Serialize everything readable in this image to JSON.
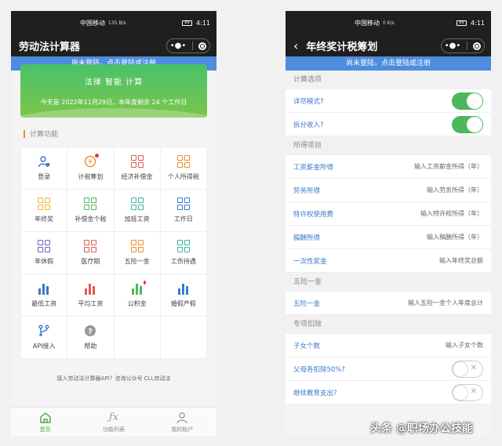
{
  "status": {
    "carrier": "中国移动",
    "net_speed": "135 B/s",
    "net_speed_right": "0 K/s",
    "battery": "89",
    "time": "4:11"
  },
  "left": {
    "title": "劳动法计算器",
    "login_hint": "尚未登陆，点击登陆或注册",
    "banner": {
      "line1": "法律 智能 计算",
      "line2": "今天是 2022年11月29日，本年度剩余 24 个工作日"
    },
    "section": "计算功能",
    "features": [
      {
        "label": "登录",
        "icon": "user-icon",
        "color": "#3b78c9"
      },
      {
        "label": "计税筹划",
        "icon": "money-icon",
        "color": "#f08c2c"
      },
      {
        "label": "经济补偿金",
        "icon": "grid-icon",
        "color": "#e05a4f"
      },
      {
        "label": "个人所得税",
        "icon": "grid-icon",
        "color": "#f08c2c"
      },
      {
        "label": "年终奖",
        "icon": "grid-icon",
        "color": "#f0b429"
      },
      {
        "label": "补偿金个税",
        "icon": "grid-icon",
        "color": "#4cb85b"
      },
      {
        "label": "加班工资",
        "icon": "grid-icon",
        "color": "#3bb5a6"
      },
      {
        "label": "工作日",
        "icon": "grid-icon",
        "color": "#3b78c9"
      },
      {
        "label": "年休假",
        "icon": "grid-icon",
        "color": "#7b5bc9"
      },
      {
        "label": "医疗期",
        "icon": "grid-icon",
        "color": "#e05a4f"
      },
      {
        "label": "五险一金",
        "icon": "grid-icon",
        "color": "#f08c2c"
      },
      {
        "label": "工伤待遇",
        "icon": "grid-icon",
        "color": "#3bb5a6"
      },
      {
        "label": "最低工资",
        "icon": "bars-icon",
        "color": "#3b78c9"
      },
      {
        "label": "平均工资",
        "icon": "bars-icon",
        "color": "#e05a4f"
      },
      {
        "label": "公积金",
        "icon": "bars-icon",
        "color": "#4cb85b"
      },
      {
        "label": "婚假产假",
        "icon": "bars-icon",
        "color": "#3b78c9"
      },
      {
        "label": "API接入",
        "icon": "branch-icon",
        "color": "#3b78c9"
      },
      {
        "label": "帮助",
        "icon": "help-icon",
        "color": "#999999"
      }
    ],
    "api_hint": "接入劳动法计算器API？咨询公众号 CLL劳动法",
    "tabs": [
      {
        "label": "首页",
        "icon": "home-icon"
      },
      {
        "label": "功能列表",
        "icon": "function-icon"
      },
      {
        "label": "我的账户",
        "icon": "account-icon"
      }
    ]
  },
  "right": {
    "title": "年终奖计税筹划",
    "login_hint": "尚未登陆，点击登陆或注册",
    "sections": {
      "options": "计算选项",
      "income": "所得项目",
      "insurance": "五险一金",
      "deduction": "专项扣除"
    },
    "options": [
      {
        "label": "详尽模式?",
        "on": true
      },
      {
        "label": "拆分收入?",
        "on": true
      }
    ],
    "income": [
      {
        "label": "工资薪金所得",
        "placeholder": "输入工资薪金所得（年）"
      },
      {
        "label": "劳务所得",
        "placeholder": "输入劳务所得（年）"
      },
      {
        "label": "特许权使用费",
        "placeholder": "输入特许权所得（年）"
      },
      {
        "label": "稿酬所得",
        "placeholder": "输入稿酬所得（年）"
      },
      {
        "label": "一次性奖金",
        "placeholder": "输入年终奖总额"
      }
    ],
    "insurance": {
      "label": "五险一金",
      "placeholder": "输入五险一金个人年度总计"
    },
    "deduction": {
      "children": {
        "label": "子女个数",
        "placeholder": "输入子女个数"
      },
      "parents": {
        "label": "父母各扣除50%?",
        "on": false
      },
      "education": {
        "label": "继续教育支出?",
        "on": false
      }
    }
  },
  "watermark": "头条 @职场办公技能"
}
